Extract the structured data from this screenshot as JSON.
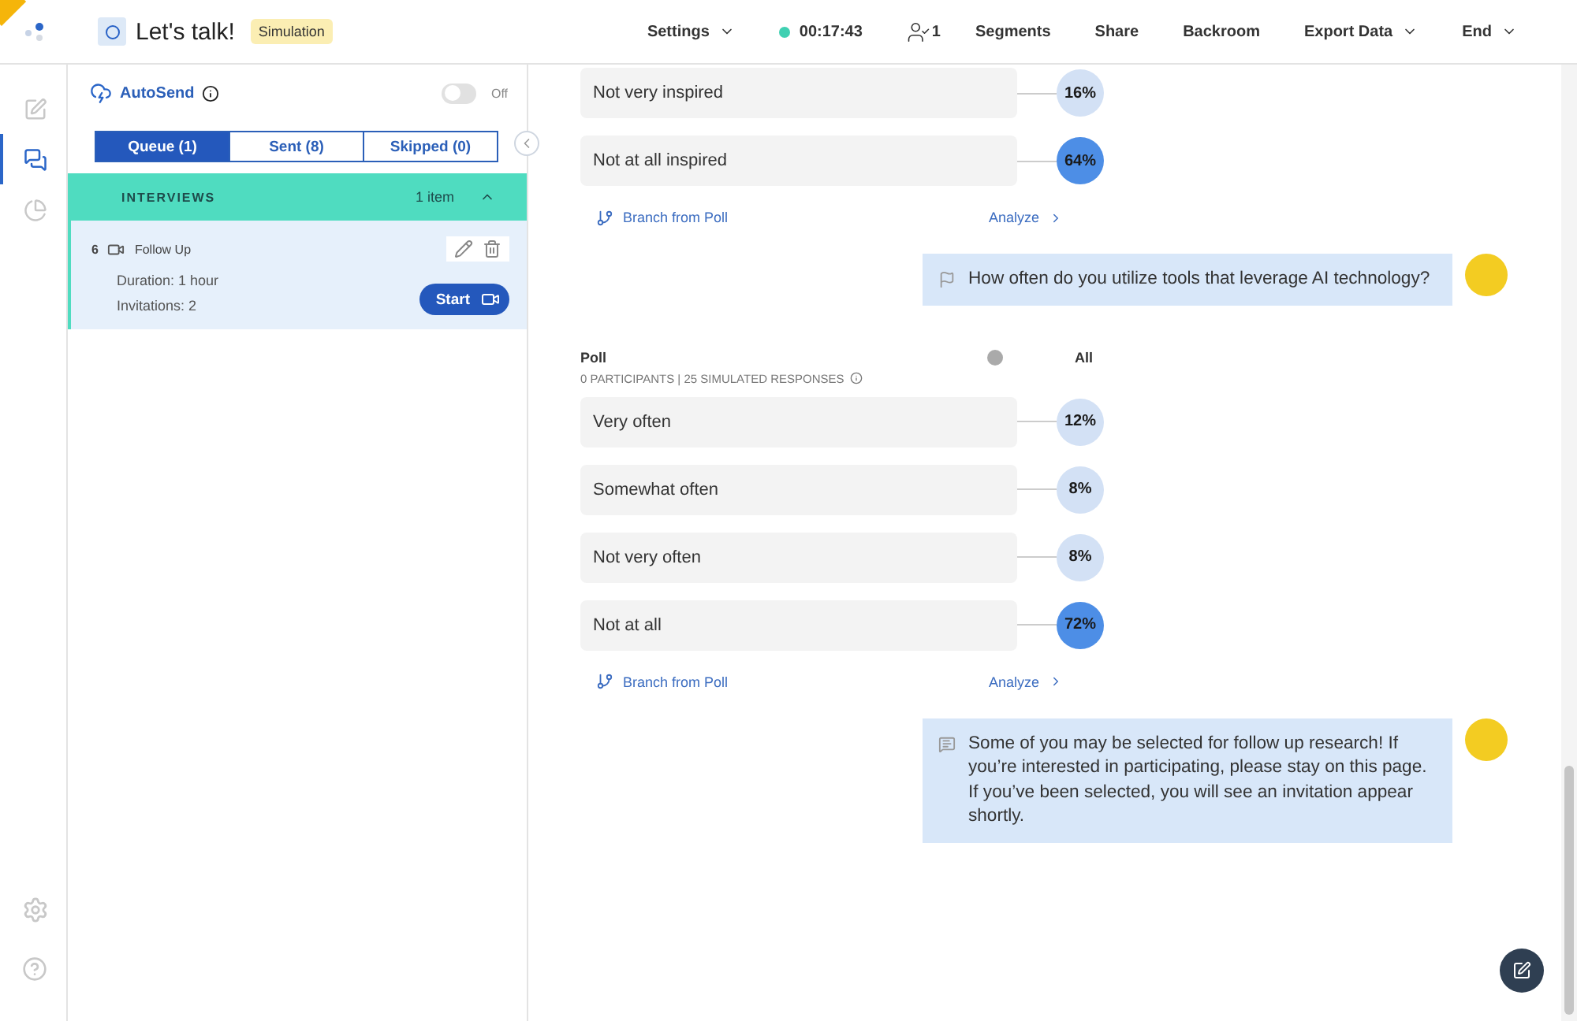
{
  "header": {
    "title": "Let's talk!",
    "badge": "Simulation",
    "nav": [
      {
        "kind": "menu",
        "label": "Settings"
      },
      {
        "kind": "timer",
        "label": "00:17:43"
      },
      {
        "kind": "people",
        "label": "1"
      },
      {
        "kind": "link",
        "label": "Segments"
      },
      {
        "kind": "link",
        "label": "Share"
      },
      {
        "kind": "link",
        "label": "Backroom"
      },
      {
        "kind": "menu",
        "label": "Export Data"
      },
      {
        "kind": "menu",
        "label": "End"
      }
    ]
  },
  "rail": {
    "items": [
      {
        "kind": "edit",
        "selected": false
      },
      {
        "kind": "chat",
        "selected": true
      },
      {
        "kind": "chart",
        "selected": false
      }
    ],
    "bottom": [
      {
        "kind": "settings"
      },
      {
        "kind": "help"
      }
    ]
  },
  "autosend": {
    "label": "AutoSend",
    "on": false,
    "state": "Off"
  },
  "tabs": [
    {
      "label": "Queue (1)",
      "selected": true
    },
    {
      "label": "Sent (8)",
      "selected": false
    },
    {
      "label": "Skipped (0)",
      "selected": false
    }
  ],
  "group": {
    "title": "INTERVIEWS",
    "count": "1 item",
    "expanded": true,
    "items": [
      {
        "number": "6",
        "title": "Follow Up",
        "duration": "Duration: 1 hour",
        "invitations": "Invitations: 2",
        "button": "Start"
      }
    ]
  },
  "feed": [
    {
      "kind": "poll",
      "options": [
        {
          "label": "Not very inspired",
          "percent": "16%",
          "highlighted": false
        },
        {
          "label": "Not at all inspired",
          "percent": "64%",
          "highlighted": true
        }
      ],
      "branch": "Branch from Poll",
      "analyze": "Analyze"
    },
    {
      "kind": "question",
      "text": "How often do you utilize tools that leverage AI technology?"
    },
    {
      "kind": "poll",
      "title": "Poll",
      "subtitle": "0 PARTICIPANTS | 25 SIMULATED RESPONSES",
      "filter": "All",
      "options": [
        {
          "label": "Very often",
          "percent": "12%",
          "highlighted": false
        },
        {
          "label": "Somewhat often",
          "percent": "8%",
          "highlighted": false
        },
        {
          "label": "Not very often",
          "percent": "8%",
          "highlighted": false
        },
        {
          "label": "Not at all",
          "percent": "72%",
          "highlighted": true
        }
      ],
      "branch": "Branch from Poll",
      "analyze": "Analyze"
    },
    {
      "kind": "announcement",
      "text": "Some of you may be selected for follow up research! If you’re interested in participating, please stay on this page. If you’ve been selected, you will see an invitation appear shortly."
    }
  ]
}
